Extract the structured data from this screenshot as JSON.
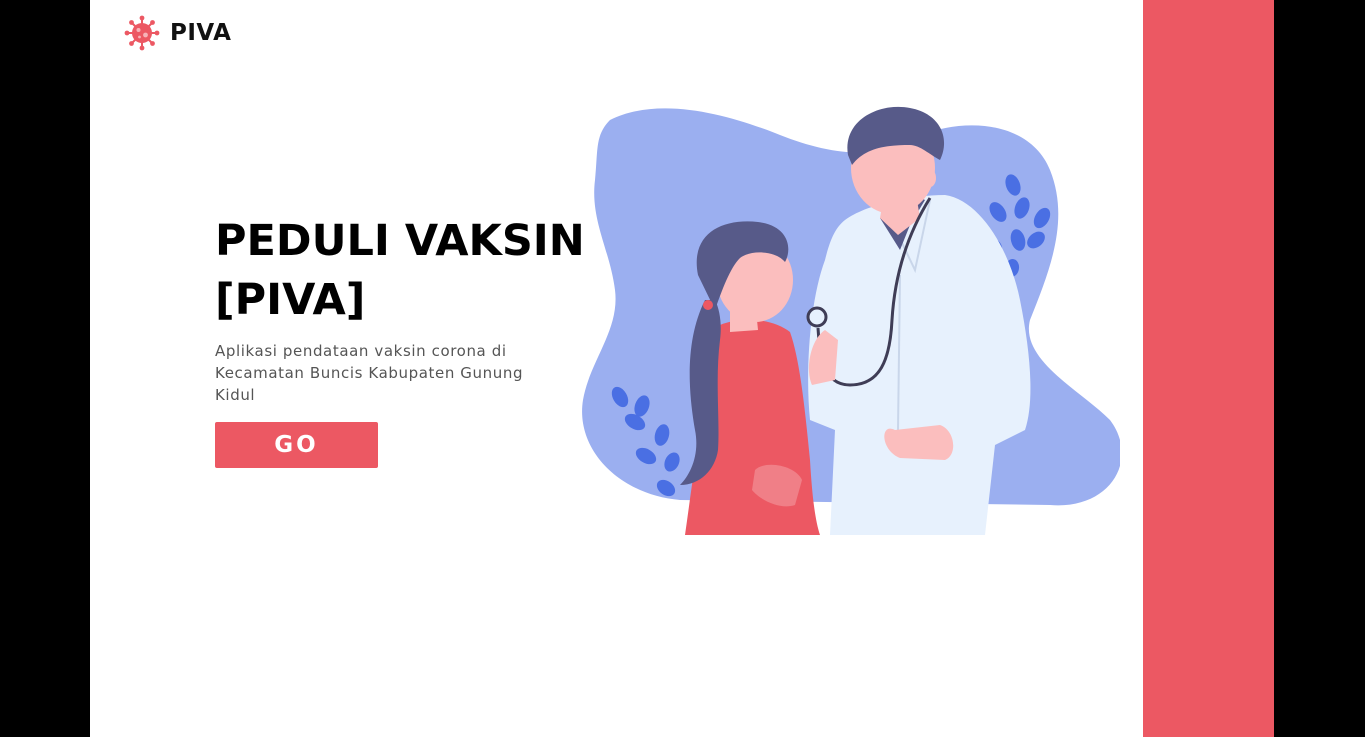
{
  "brand": {
    "name": "PIVA",
    "icon": "virus-icon"
  },
  "hero": {
    "title_line1": "PEDULI VAKSIN",
    "title_line2": "[PIVA]",
    "subtitle": "Aplikasi pendataan vaksin corona di Kecamatan Buncis Kabupaten Gunung Kidul",
    "button_label": "GO",
    "illustration": "doctor-patient-illustration"
  },
  "colors": {
    "accent": "#ec5863",
    "blob": "#9baff0",
    "hair": "#575a89",
    "leaf": "#4a6fe3",
    "background": "#ffffff",
    "outer": "#000000"
  }
}
